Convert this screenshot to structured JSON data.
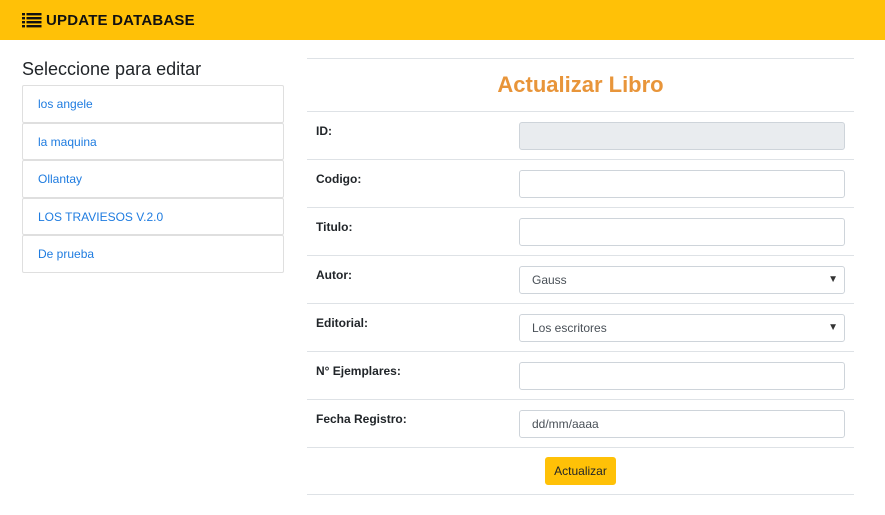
{
  "navbar": {
    "brand": "UPDATE DATABASE",
    "icon": "list-icon",
    "color": "#ffc107"
  },
  "sidebar": {
    "title": "Seleccione para editar",
    "items": [
      {
        "label": "los angele"
      },
      {
        "label": "la maquina"
      },
      {
        "label": "Ollantay"
      },
      {
        "label": "LOS TRAVIESOS V.2.0"
      },
      {
        "label": "De prueba"
      }
    ]
  },
  "form": {
    "title": "Actualizar Libro",
    "fields": {
      "id": {
        "label": "ID:",
        "value": ""
      },
      "codigo": {
        "label": "Codigo:",
        "value": ""
      },
      "titulo": {
        "label": "Titulo:",
        "value": ""
      },
      "autor": {
        "label": "Autor:",
        "value": "Gauss"
      },
      "editorial": {
        "label": "Editorial:",
        "value": "Los escritores"
      },
      "ejemplares": {
        "label": "N° Ejemplares:",
        "value": ""
      },
      "fecha": {
        "label": "Fecha Registro:",
        "placeholder": "dd/mm/aaaa"
      }
    },
    "submit_label": "Actualizar"
  }
}
